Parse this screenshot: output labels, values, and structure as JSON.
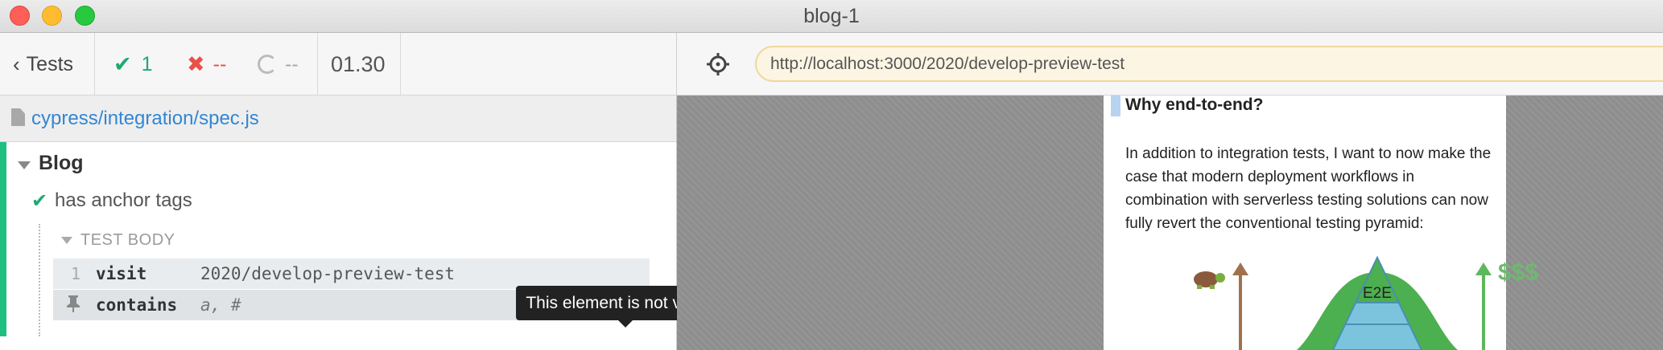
{
  "window": {
    "title": "blog-1"
  },
  "reporter": {
    "back_label": "Tests",
    "passed_count": "1",
    "failed_count": "--",
    "pending_count": "--",
    "duration": "01.30",
    "spec_file": "cypress/integration/spec.js",
    "suite_title": "Blog",
    "test_title": "has anchor tags",
    "test_body_label": "TEST BODY",
    "commands": [
      {
        "number": "1",
        "name": "visit",
        "message": "2020/develop-preview-test"
      },
      {
        "number": "",
        "name": "contains",
        "message": "a, #"
      }
    ],
    "tooltip": "This element is not visible."
  },
  "aut": {
    "url": "http://localhost:3000/2020/develop-preview-test",
    "heading": "Why end-to-end?",
    "paragraph": "In addition to integration tests, I want to now make the case that modern deployment workflows in combination with serverless testing solutions can now fully revert the conventional testing pyramid:",
    "pyramid_label": "E2E",
    "cost_label": "$$$"
  },
  "colors": {
    "passed": "#1fa971",
    "failed": "#e94f4b",
    "link": "#3386d4",
    "url_bg": "#fdf5e3",
    "pyramid_top": "#4caf50",
    "pyramid_mid": "#7cc4dd"
  },
  "icons": [
    "chevron-left-icon",
    "checkmark-icon",
    "x-icon",
    "spinner-icon",
    "status-dot-icon",
    "updown-arrows-icon",
    "reload-icon",
    "file-icon",
    "pin-icon",
    "eye-slash-icon",
    "crosshair-icon",
    "turtle-icon"
  ]
}
